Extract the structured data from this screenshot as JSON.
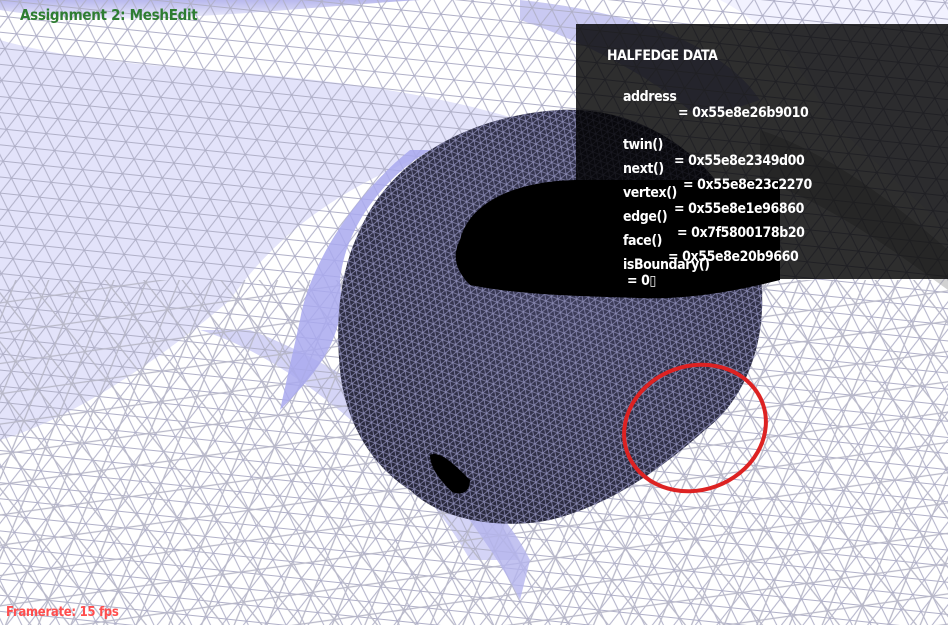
{
  "app": {
    "title": "Assignment 2: MeshEdit"
  },
  "hud": {
    "title": "HALFEDGE DATA",
    "rows": [
      {
        "label": "address",
        "value": "= 0x55e8e26b9010"
      },
      {
        "label": "twin()",
        "value": "= 0x55e8e2349d00"
      },
      {
        "label": "next()",
        "value": "= 0x55e8e23c2270"
      },
      {
        "label": "vertex()",
        "value": "= 0x55e8e1e96860"
      },
      {
        "label": "edge()",
        "value": "= 0x7f5800178b20"
      },
      {
        "label": "face()",
        "value": "= 0x55e8e20b9660"
      },
      {
        "label": "isBoundary()",
        "value": "= 0▯"
      }
    ]
  },
  "status": {
    "framerate": "Framerate: 15 fps"
  },
  "colors": {
    "mesh_fill": "#ffffff",
    "mesh_lines": "#b8b8c8",
    "shadow_blue": "#c9c9f2",
    "object_dark": "#33334d",
    "object_lines": "#8a8ab4",
    "highlight_circle": "#dd2222",
    "title_green": "#2e7d32",
    "framerate_red": "#ff4d4d"
  }
}
